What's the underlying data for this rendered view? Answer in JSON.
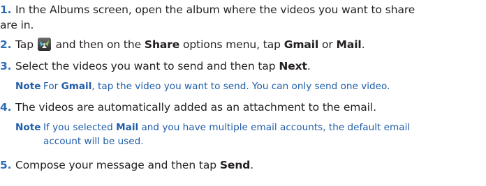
{
  "steps": [
    {
      "number": "1.",
      "line1": "In the Albums screen, open the album where the videos you want to share",
      "line2": "are in."
    },
    {
      "number": "2.",
      "part1": "Tap ",
      "part2": " and then on the ",
      "bold1": "Share",
      "part3": " options menu, tap ",
      "bold2": "Gmail",
      "part4": " or ",
      "bold3": "Mail",
      "part5": ".",
      "icon": "share-menu-icon"
    },
    {
      "number": "3.",
      "part1": "Select the videos you want to send and then tap ",
      "bold1": "Next",
      "part2": "."
    },
    {
      "number": "4.",
      "text": "The videos are automatically added as an attachment to the email."
    },
    {
      "number": "5.",
      "part1": "Compose your message and then tap ",
      "bold1": "Send",
      "part2": "."
    }
  ],
  "notes": [
    {
      "label": "Note",
      "part1": "For ",
      "bold1": "Gmail",
      "part2": ", tap the video you want to send. You can only send one video."
    },
    {
      "label": "Note",
      "part1": "If you selected ",
      "bold1": "Mail",
      "part2": " and you have multiple email accounts, the default email",
      "line2": "account will be used."
    }
  ],
  "colors": {
    "step_number": "#2e6cb5",
    "note_text": "#1f5da8",
    "body_text": "#231f20"
  }
}
